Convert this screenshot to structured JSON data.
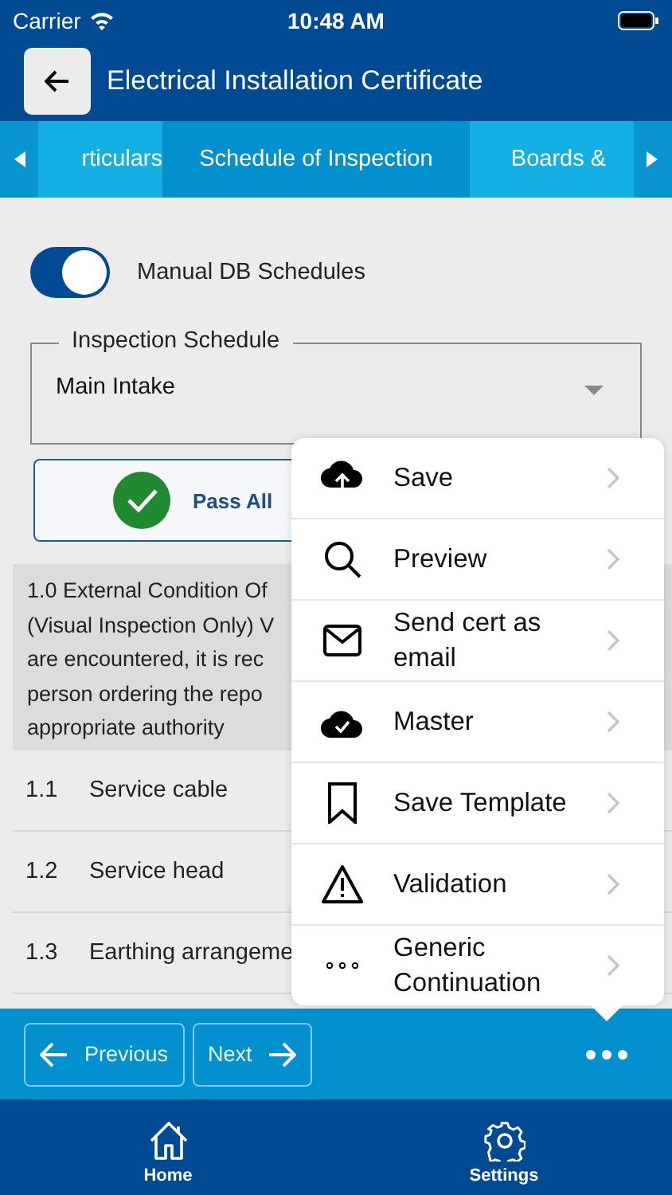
{
  "status_bar": {
    "carrier": "Carrier",
    "time": "10:48 AM"
  },
  "header": {
    "title": "Electrical Installation Certificate"
  },
  "tabs": [
    {
      "label": "rticulars",
      "selected": false
    },
    {
      "label": "Schedule of Inspection",
      "selected": true
    },
    {
      "label": "Boards &",
      "selected": false
    }
  ],
  "toggle": {
    "label": "Manual DB Schedules",
    "on": true
  },
  "schedule_select": {
    "label": "Inspection Schedule",
    "value": "Main Intake"
  },
  "pass_all": {
    "label": "Pass All"
  },
  "section": {
    "lines": [
      "1.0 External Condition Of",
      "(Visual Inspection Only) V",
      "are encountered, it is rec",
      "person ordering the repo",
      "appropriate authority"
    ]
  },
  "rows": [
    {
      "number": "1.1",
      "label": "Service cable"
    },
    {
      "number": "1.2",
      "label": "Service head"
    },
    {
      "number": "1.3",
      "label": "Earthing arrangeme"
    }
  ],
  "menu": [
    {
      "kind": "save",
      "label": "Save"
    },
    {
      "kind": "preview",
      "label": "Preview"
    },
    {
      "kind": "email",
      "label": "Send cert as email"
    },
    {
      "kind": "master",
      "label": "Master"
    },
    {
      "kind": "template",
      "label": "Save Template"
    },
    {
      "kind": "validation",
      "label": "Validation"
    },
    {
      "kind": "more",
      "label": "Generic Continuation"
    }
  ],
  "nav": {
    "previous": "Previous",
    "next": "Next"
  },
  "tab_bar": [
    {
      "kind": "home",
      "label": "Home"
    },
    {
      "kind": "settings",
      "label": "Settings"
    }
  ]
}
